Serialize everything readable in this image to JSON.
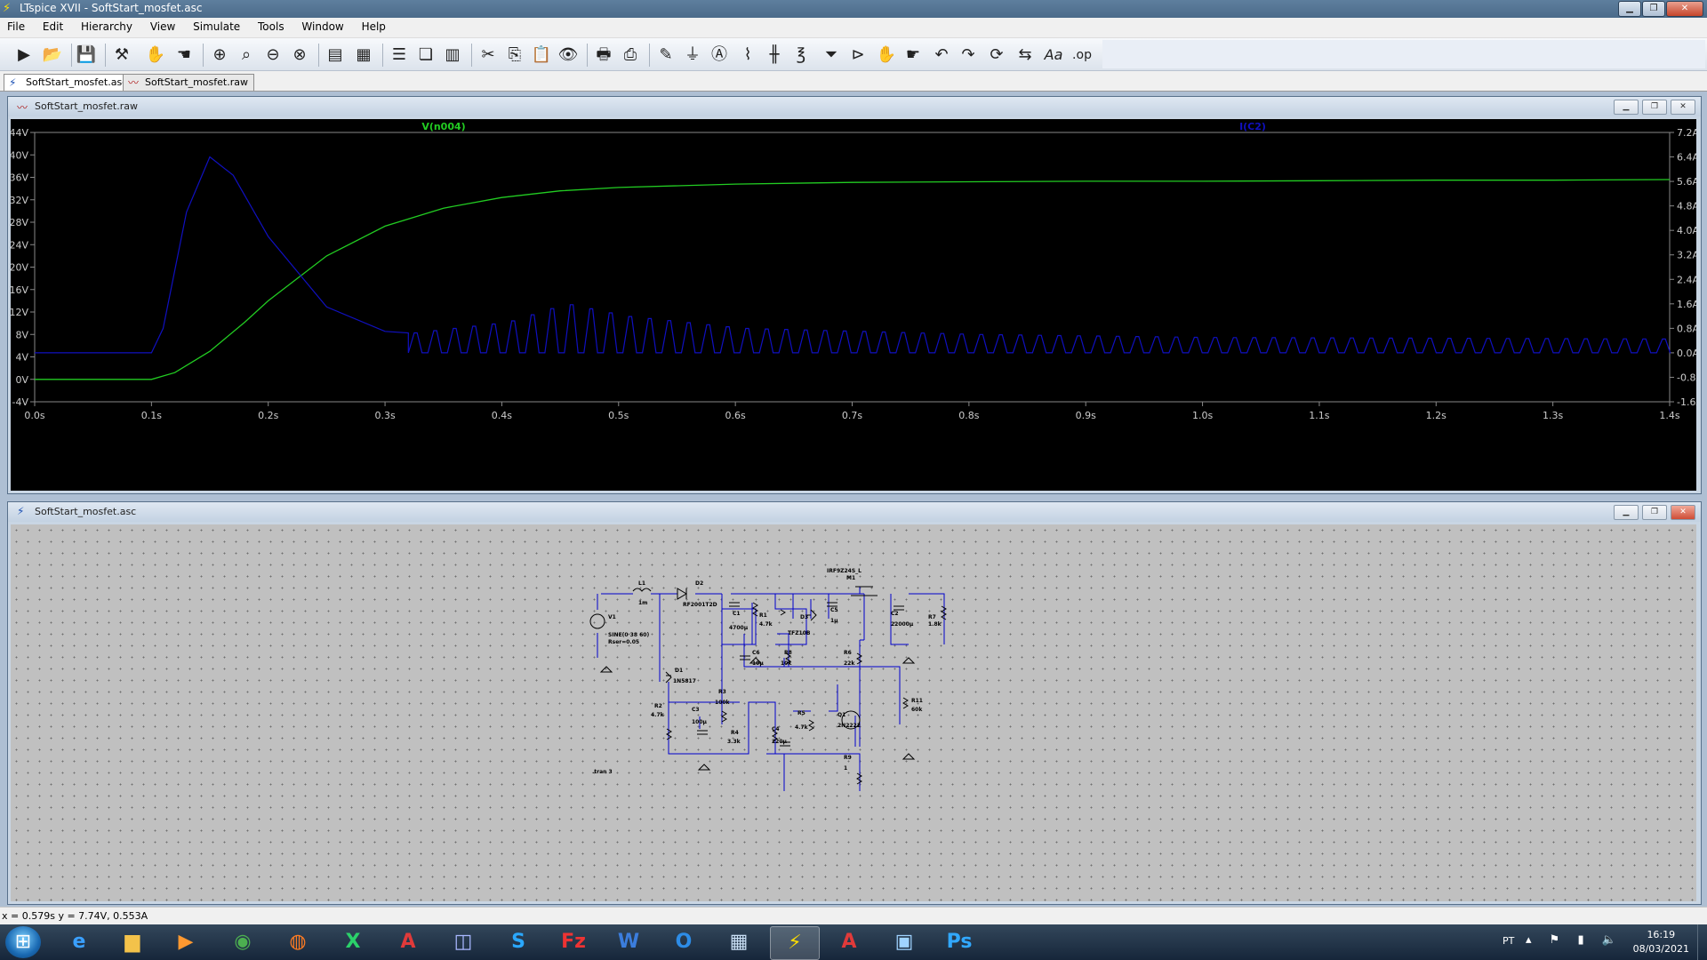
{
  "window": {
    "title": "LTspice XVII - SoftStart_mosfet.asc"
  },
  "menu": [
    "File",
    "Edit",
    "Hierarchy",
    "View",
    "Simulate",
    "Tools",
    "Window",
    "Help"
  ],
  "toolbar_icons": [
    "run-icon",
    "open-icon",
    "save-icon",
    "control-panel-icon",
    "halt-icon",
    "pan-icon",
    "zoom-in-icon",
    "zoom-full-icon",
    "zoom-out-icon",
    "zoom-cancel-icon",
    "autorange-icon",
    "draft-icon",
    "tile-horizontal-icon",
    "cascade-icon",
    "tile-vertical-icon",
    "cut-icon",
    "copy-icon",
    "paste-icon",
    "find-icon",
    "print-setup-icon",
    "print-icon",
    "wire-icon",
    "ground-icon",
    "label-icon",
    "resistor-icon",
    "capacitor-icon",
    "inductor-icon",
    "diode-icon",
    "component-icon",
    "move-icon",
    "drag-icon",
    "undo-icon",
    "redo-icon",
    "rotate-icon",
    "mirror-icon",
    "text-icon",
    "spice-directive-icon"
  ],
  "tabs": [
    {
      "label": "SoftStart_mosfet.asc",
      "active": true
    },
    {
      "label": "SoftStart_mosfet.raw",
      "active": false
    }
  ],
  "plot_window": {
    "title": "SoftStart_mosfet.raw"
  },
  "schematic_window": {
    "title": "SoftStart_mosfet.asc"
  },
  "colors": {
    "trace_voltage": "#22cc22",
    "trace_current": "#1010c0",
    "plot_bg": "#000000",
    "schematic_bg": "#c0c0c0",
    "wire": "#0000cc"
  },
  "chart_data": {
    "type": "line",
    "series": [
      {
        "name": "V(n004)",
        "axis": "left",
        "color": "#22cc22",
        "x": [
          0,
          0.1,
          0.12,
          0.15,
          0.18,
          0.2,
          0.25,
          0.3,
          0.35,
          0.4,
          0.45,
          0.5,
          0.6,
          0.7,
          0.8,
          0.9,
          1.0,
          1.1,
          1.2,
          1.3,
          1.4
        ],
        "y": [
          0,
          0,
          1.2,
          5,
          10.2,
          14,
          22,
          27.3,
          30.5,
          32.4,
          33.6,
          34.2,
          34.8,
          35.1,
          35.2,
          35.3,
          35.3,
          35.4,
          35.5,
          35.5,
          35.6
        ]
      },
      {
        "name": "I(C2)",
        "axis": "right",
        "color": "#1010c0",
        "x": [
          0,
          0.1,
          0.11,
          0.13,
          0.15,
          0.17,
          0.2,
          0.25,
          0.3,
          0.32
        ],
        "y": [
          0.0,
          0.0,
          0.8,
          4.6,
          6.4,
          5.8,
          3.8,
          1.5,
          0.7,
          0.65
        ],
        "pulses_start": 0.32,
        "pulses_end": 1.4,
        "pulse_period": 0.0167,
        "pulse_peaks": [
          [
            0.32,
            0.65
          ],
          [
            0.4,
            1.0
          ],
          [
            0.45,
            1.6
          ],
          [
            0.5,
            1.2
          ],
          [
            0.6,
            0.8
          ],
          [
            0.8,
            0.6
          ],
          [
            1.0,
            0.5
          ],
          [
            1.4,
            0.45
          ]
        ]
      }
    ],
    "xlabel": "",
    "x_range": [
      0,
      1.4
    ],
    "x_ticks": [
      "0.0s",
      "0.1s",
      "0.2s",
      "0.3s",
      "0.4s",
      "0.5s",
      "0.6s",
      "0.7s",
      "0.8s",
      "0.9s",
      "1.0s",
      "1.1s",
      "1.2s",
      "1.3s",
      "1.4s"
    ],
    "y_left_range": [
      -4,
      44
    ],
    "y_left_ticks": [
      "44V",
      "40V",
      "36V",
      "32V",
      "28V",
      "24V",
      "20V",
      "16V",
      "12V",
      "8V",
      "4V",
      "0V",
      "-4V"
    ],
    "y_right_range": [
      -1.6,
      7.2
    ],
    "y_right_ticks": [
      "7.2A",
      "6.4A",
      "5.6A",
      "4.8A",
      "4.0A",
      "3.2A",
      "2.4A",
      "1.6A",
      "0.8A",
      "0.0A",
      "-0.8A",
      "-1.6A"
    ],
    "grid": false,
    "legend": "top"
  },
  "schematic": {
    "labels": {
      "L1": "L1",
      "L1v": "1m",
      "D2": "D2",
      "D2v": "RF2001T2D",
      "V1": "V1",
      "V1v": "SINE(0 38 60)",
      "V1r": "Rser=0.05",
      "C1": "C1",
      "C1v": "4700µ",
      "R1": "R1",
      "R1v": "4.7k",
      "D3": "D3",
      "D3v": "TFZ10B",
      "C5": "C5",
      "C5v": "1µ",
      "M1": "M1",
      "M1v": "IRF9Z24S_L",
      "C2": "C2",
      "C2v": "22000µ",
      "R7": "R7",
      "R7v": "1.8k",
      "C6": "C6",
      "C6v": "10µ",
      "R8": "R8",
      "R8v": "10k",
      "R6": "R6",
      "R6v": "22k",
      "D1": "D1",
      "D1v": "1N5817",
      "R3": "R3",
      "R3v": "100k",
      "R11": "R11",
      "R11v": "60k",
      "R2": "R2",
      "R2v": "4.7k",
      "C3": "C3",
      "C3v": "100µ",
      "R5": "R5",
      "R5v": "4.7k",
      "Q1": "Q1",
      "Q1v": "2N2222",
      "R4": "R4",
      "R4v": "3.3k",
      "C4": "C4",
      "C4v": "220µ",
      "R9": "R9",
      "R9v": "1",
      "tran": ".tran 3"
    }
  },
  "status": {
    "text": "x = 0.579s    y = 7.74V, 0.553A"
  },
  "taskbar": {
    "apps": [
      "internet-explorer-icon",
      "file-explorer-icon",
      "media-player-icon",
      "chrome-icon",
      "firefox-icon",
      "excel-icon",
      "access-icon",
      "project-icon",
      "skype-icon",
      "filezilla-icon",
      "word-icon",
      "outlook-icon",
      "calculator-icon",
      "ltspice-icon",
      "access-icon-2",
      "remote-desktop-icon",
      "photoshop-icon"
    ],
    "lang": "PT",
    "time": "16:19",
    "date": "08/03/2021"
  }
}
